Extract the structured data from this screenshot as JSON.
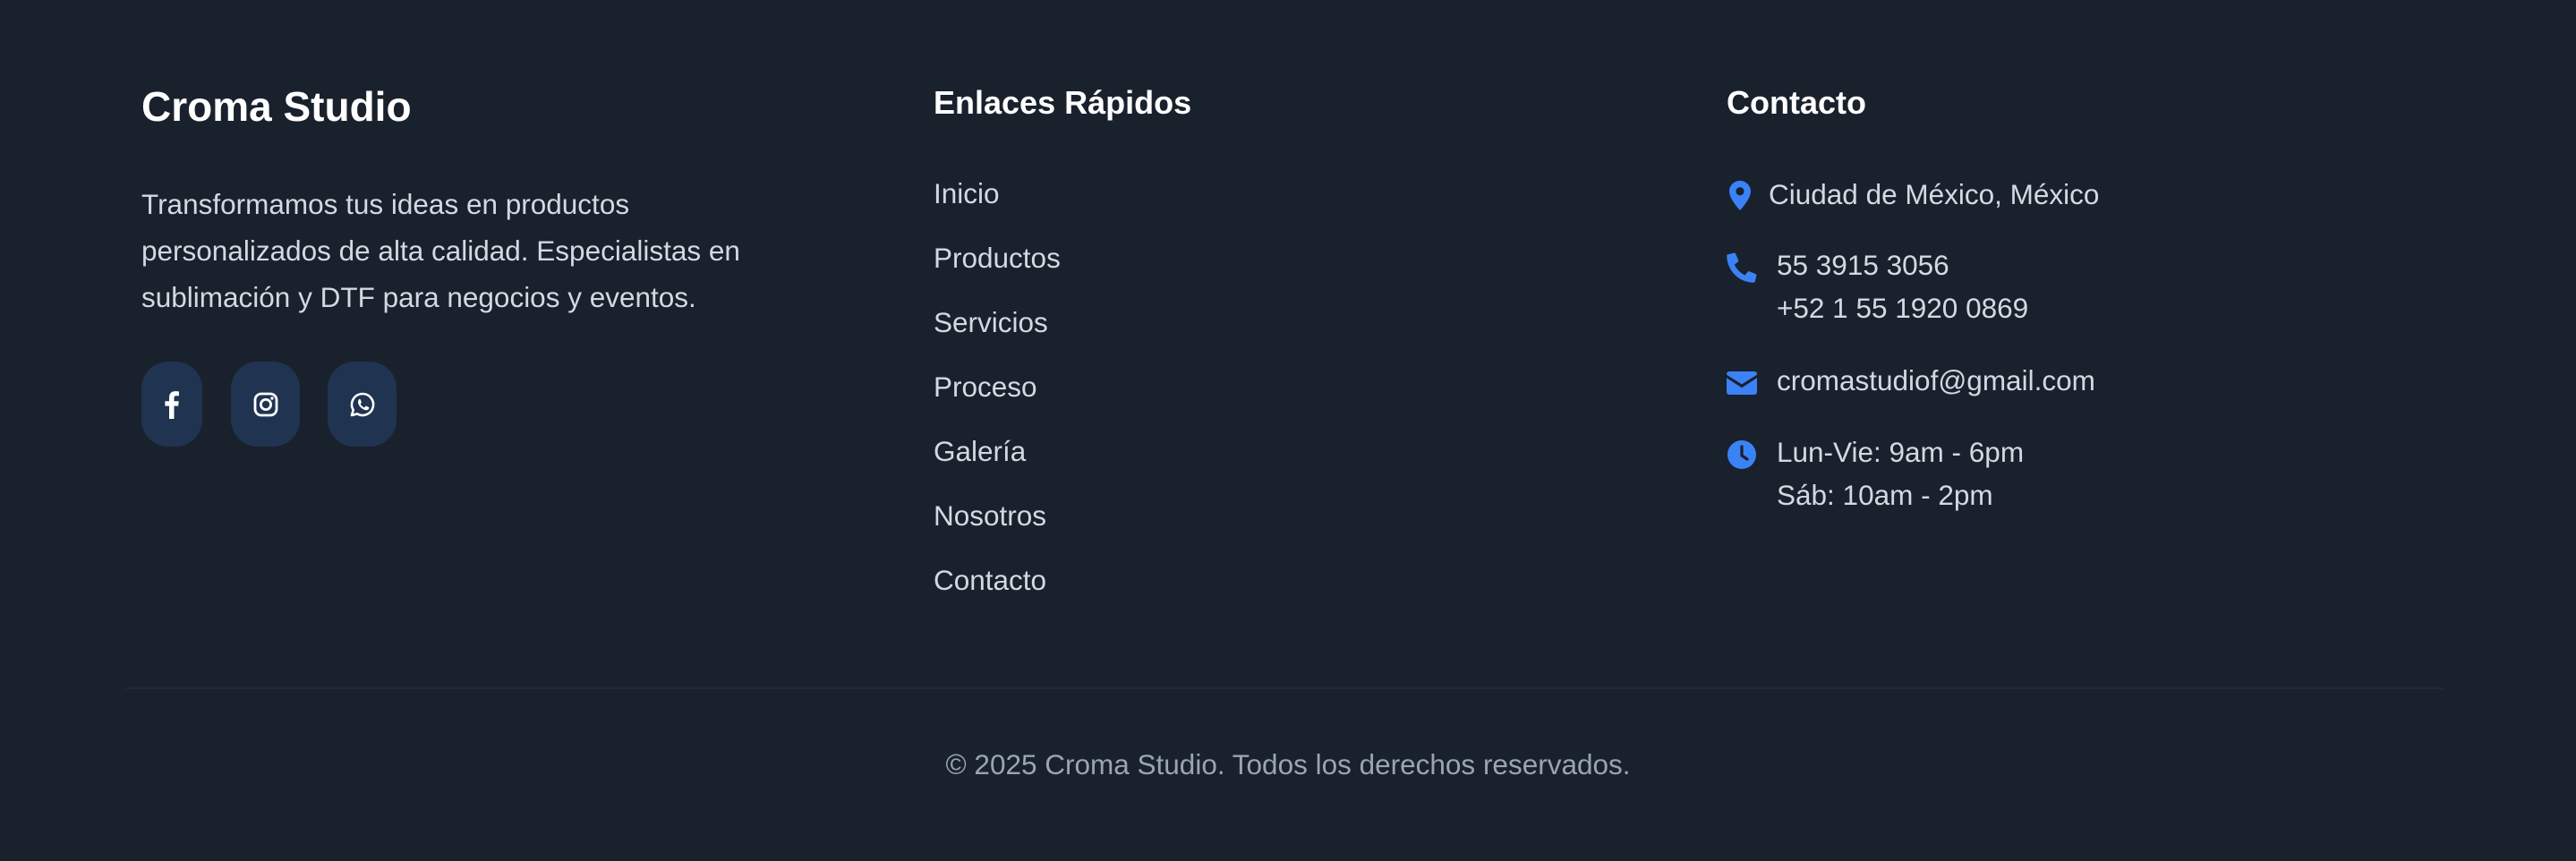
{
  "brand": {
    "title": "Croma Studio",
    "description": "Transformamos tus ideas en productos personalizados de alta calidad. Especialistas en sublimación y DTF para negocios y eventos.",
    "socials": [
      {
        "name": "facebook",
        "icon": "facebook-icon"
      },
      {
        "name": "instagram",
        "icon": "instagram-icon"
      },
      {
        "name": "whatsapp",
        "icon": "whatsapp-icon"
      }
    ]
  },
  "quick_links": {
    "title": "Enlaces Rápidos",
    "items": [
      "Inicio",
      "Productos",
      "Servicios",
      "Proceso",
      "Galería",
      "Nosotros",
      "Contacto"
    ]
  },
  "contact": {
    "title": "Contacto",
    "location": "Ciudad de México, México",
    "phone_1": "55 3915 3056",
    "phone_2": "+52 1 55 1920 0869",
    "email": "cromastudiof@gmail.com",
    "hours_1": "Lun-Vie: 9am - 6pm",
    "hours_2": "Sáb: 10am - 2pm",
    "icons": {
      "location": "map-pin-icon",
      "phone": "phone-icon",
      "email": "envelope-icon",
      "hours": "clock-icon"
    }
  },
  "footer": {
    "copyright": "© 2025 Croma Studio. Todos los derechos reservados."
  },
  "colors": {
    "background": "#19212d",
    "accent": "#3b82f6",
    "social_bg": "#203350",
    "text": "#d3d9e2",
    "muted": "#9aa4b2"
  }
}
